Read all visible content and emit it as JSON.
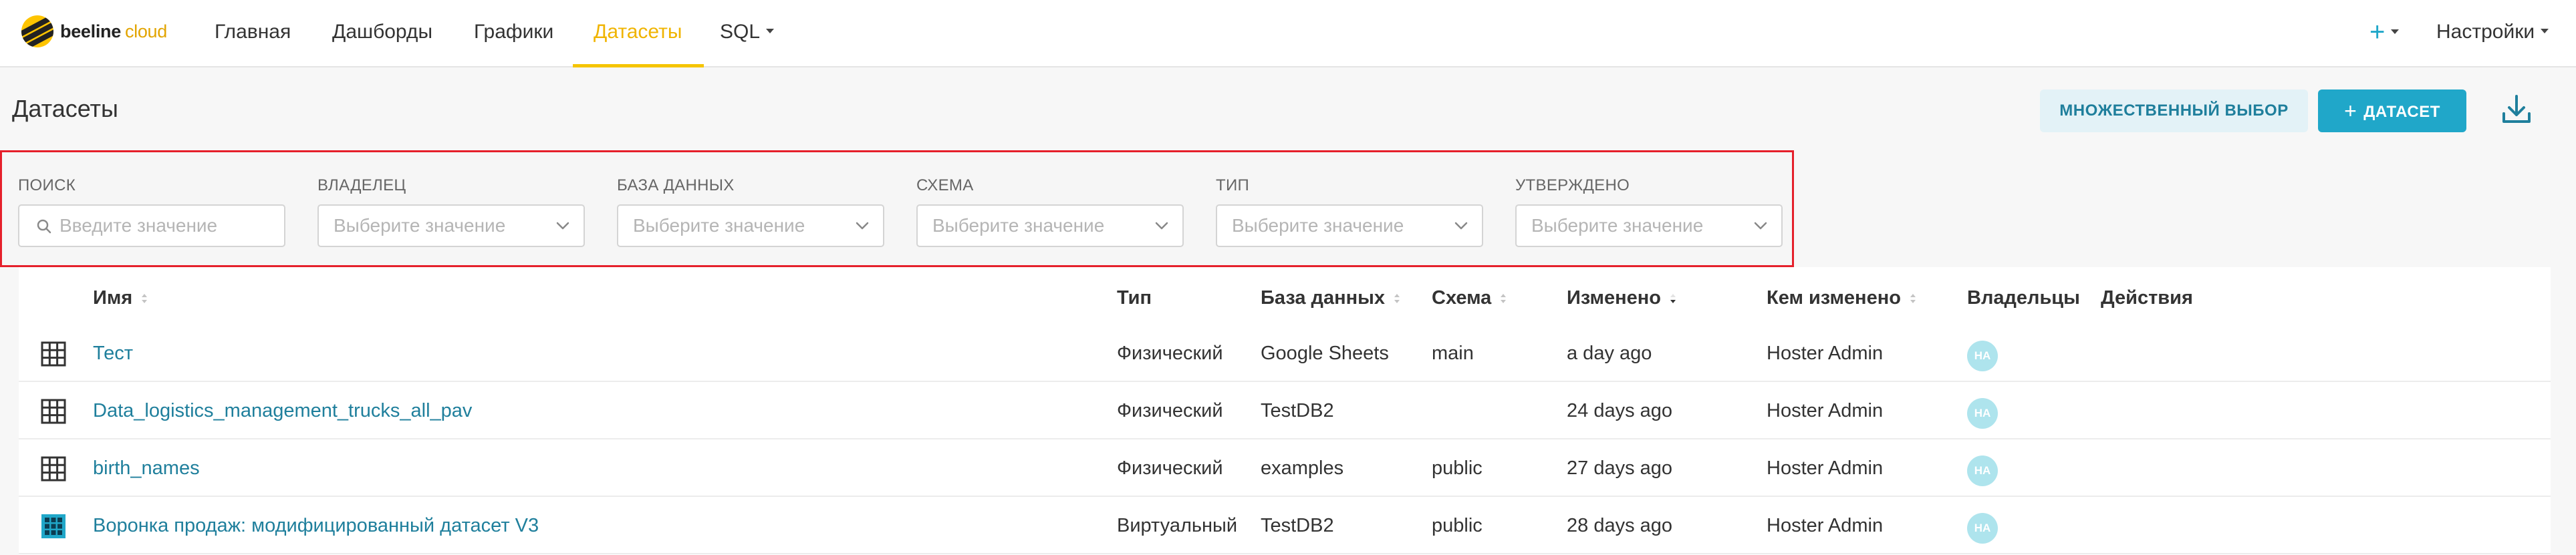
{
  "brand": {
    "name": "beeline",
    "suffix": "cloud"
  },
  "nav": {
    "items": [
      {
        "label": "Главная"
      },
      {
        "label": "Дашборды"
      },
      {
        "label": "Графики"
      },
      {
        "label": "Датасеты",
        "active": true
      },
      {
        "label": "SQL",
        "dropdown": true
      }
    ],
    "add_label": "+",
    "settings_label": "Настройки"
  },
  "header": {
    "title": "Датасеты",
    "multi_select_label": "МНОЖЕСТВЕННЫЙ ВЫБОР",
    "add_dataset_plus": "+",
    "add_dataset_label": "ДАТАСЕТ",
    "download_icon": "download-icon"
  },
  "filters": [
    {
      "label": "ПОИСК",
      "placeholder": "Введите значение",
      "type": "search"
    },
    {
      "label": "ВЛАДЕЛЕЦ",
      "placeholder": "Выберите значение",
      "type": "select"
    },
    {
      "label": "БАЗА ДАННЫХ",
      "placeholder": "Выберите значение",
      "type": "select"
    },
    {
      "label": "СХЕМА",
      "placeholder": "Выберите значение",
      "type": "select"
    },
    {
      "label": "ТИП",
      "placeholder": "Выберите значение",
      "type": "select"
    },
    {
      "label": "УТВЕРЖДЕНО",
      "placeholder": "Выберите значение",
      "type": "select"
    }
  ],
  "table": {
    "columns": [
      {
        "label": "Имя",
        "sortable": true
      },
      {
        "label": "Тип",
        "sortable": false
      },
      {
        "label": "База данных",
        "sortable": true
      },
      {
        "label": "Схема",
        "sortable": true
      },
      {
        "label": "Изменено",
        "sortable": true,
        "sorted": "desc"
      },
      {
        "label": "Кем изменено",
        "sortable": true
      },
      {
        "label": "Владельцы",
        "sortable": false
      },
      {
        "label": "Действия",
        "sortable": false
      }
    ],
    "rows": [
      {
        "icon": "physical-dataset-icon",
        "name": "Тест",
        "type": "Физический",
        "database": "Google Sheets",
        "schema": "main",
        "modified": "a day ago",
        "modified_by": "Hoster Admin",
        "owner_initials": "HA"
      },
      {
        "icon": "physical-dataset-icon",
        "name": "Data_logistics_management_trucks_all_pav",
        "type": "Физический",
        "database": "TestDB2",
        "schema": "",
        "modified": "24 days ago",
        "modified_by": "Hoster Admin",
        "owner_initials": "HA"
      },
      {
        "icon": "physical-dataset-icon",
        "name": "birth_names",
        "type": "Физический",
        "database": "examples",
        "schema": "public",
        "modified": "27 days ago",
        "modified_by": "Hoster Admin",
        "owner_initials": "HA"
      },
      {
        "icon": "virtual-dataset-icon",
        "name": "Воронка продаж: модифицированный датасет V3",
        "type": "Виртуальный",
        "database": "TestDB2",
        "schema": "public",
        "modified": "28 days ago",
        "modified_by": "Hoster Admin",
        "owner_initials": "HA"
      }
    ]
  },
  "colors": {
    "brand_yellow": "#fec400",
    "accent_blue": "#20a7c9",
    "link_blue": "#1f7f9c",
    "highlight_red": "#e5202b",
    "avatar_bg": "#aee4ed"
  }
}
